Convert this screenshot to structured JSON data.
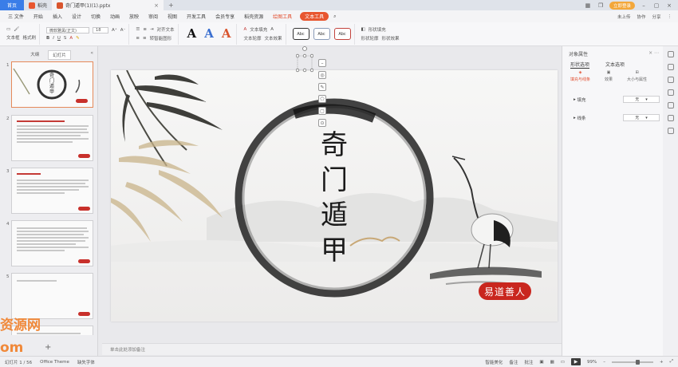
{
  "tabbar": {
    "home": "首页",
    "tab_daoke": "稻壳",
    "doc_tab": "奇门遁甲(1)(1).pptx",
    "add": "+",
    "login": "立即登录"
  },
  "menu": {
    "items": [
      "三 文件",
      "开始",
      "插入",
      "设计",
      "切换",
      "动画",
      "放映",
      "审阅",
      "视图",
      "开发工具",
      "会员专享",
      "稻壳资源"
    ],
    "drawing_tools": "绘图工具",
    "text_tools": "文本工具",
    "right": [
      "未上传",
      "协作",
      "分享"
    ]
  },
  "ribbon": {
    "paste": "文本框",
    "format_brush": "格式刷",
    "font_name": "微软雅黑(正文)",
    "font_size": "18",
    "font_grow": "A⁺",
    "font_shrink": "A⁻",
    "bold": "B",
    "italic": "I",
    "underline": "U",
    "align_text": "对齐文本",
    "convert_smart": "转智能图形",
    "text_fill": "文本填充",
    "text_outline": "文本轮廓",
    "text_effect": "文本效果",
    "shape_fill": "形状填充",
    "shape_outline": "形状轮廓",
    "shape_effect": "形状效果",
    "style_label": "Abc"
  },
  "left_panel": {
    "tab_outline": "大纲",
    "tab_slides": "幻灯片",
    "thumb_numbers": [
      "1",
      "2",
      "3",
      "4",
      "5"
    ],
    "thumb1_title": "奇门遁甲",
    "add": "+"
  },
  "watermark": {
    "line1": "资源网",
    "line2": "om"
  },
  "slide": {
    "title_chars": [
      "奇",
      "门",
      "遁",
      "甲"
    ],
    "seal_text": "易道善人"
  },
  "notes_placeholder": "单击此处添加备注",
  "right_panel": {
    "title": "对象属性",
    "tabs": [
      "形状选项",
      "文本选项"
    ],
    "icons": [
      "填充与线条",
      "效果",
      "大小与属性"
    ],
    "fill_label": "填充",
    "fill_value": "无",
    "line_label": "线条",
    "line_value": "无"
  },
  "statusbar": {
    "slide_count": "幻灯片 1 / 56",
    "theme": "Office Theme",
    "font_missing": "缺失字体",
    "smart_beautify": "智能美化",
    "notes": "备注",
    "comment": "批注",
    "zoom": "99%"
  },
  "colors": {
    "accent": "#e8562f",
    "home_tab": "#3a7de8",
    "seal": "#c9261e",
    "watermark": "#f0893a"
  }
}
